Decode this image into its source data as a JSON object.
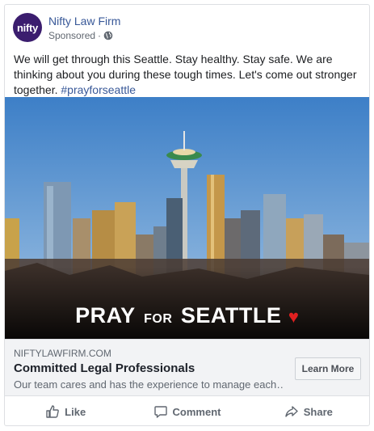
{
  "ad": {
    "page_name": "Nifty Law Firm",
    "avatar_text": "nifty",
    "sponsored_label": "Sponsored",
    "separator": "·",
    "post_text": "We will get through this Seattle. Stay healthy. Stay safe. We are thinking about you during these tough times. Let's come out stronger together.",
    "hashtag": "#prayforseattle"
  },
  "hero": {
    "caption_word1": "PRAY",
    "caption_word2": "FOR",
    "caption_word3": "SEATTLE",
    "heart": "♥"
  },
  "link_preview": {
    "domain": "NIFTYLAWFIRM.COM",
    "headline": "Committed Legal Professionals",
    "description": "Our team cares and has the experience to manage each…",
    "cta_label": "Learn More"
  },
  "actions": {
    "like": "Like",
    "comment": "Comment",
    "share": "Share"
  },
  "colors": {
    "brand_purple": "#3b1d6e",
    "link_blue": "#385898",
    "heart_red": "#e02020"
  },
  "icons": [
    "globe-icon",
    "like-icon",
    "comment-icon",
    "share-icon"
  ]
}
